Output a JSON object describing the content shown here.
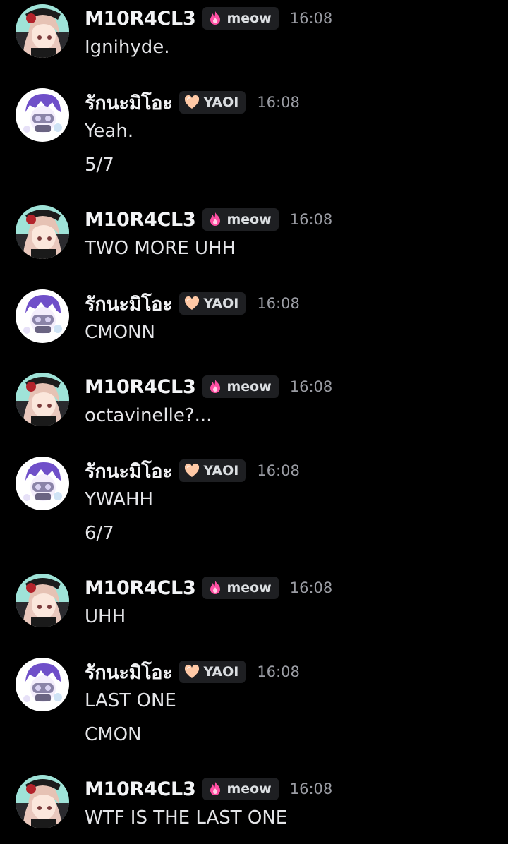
{
  "users": {
    "miracle": {
      "name": "M10R4CL3",
      "tag": "meow",
      "tag_icon": "pink-flame-icon",
      "tag_icon_color": "#ff4fa3"
    },
    "thai": {
      "name": "รักนะมิโอะ",
      "tag": "YAOI",
      "tag_icon": "peach-heart-icon",
      "tag_icon_color": "#ffc9a6"
    }
  },
  "messages": [
    {
      "user": "M10R4CL3",
      "tag": "meow",
      "time": "16:08",
      "lines": [
        "Ignihyde."
      ]
    },
    {
      "user": "รักนะมิโอะ",
      "tag": "YAOI",
      "time": "16:08",
      "lines": [
        "Yeah.",
        "5/7"
      ]
    },
    {
      "user": "M10R4CL3",
      "tag": "meow",
      "time": "16:08",
      "lines": [
        "TWO MORE UHH"
      ]
    },
    {
      "user": "รักนะมิโอะ",
      "tag": "YAOI",
      "time": "16:08",
      "lines": [
        "CMONN"
      ]
    },
    {
      "user": "M10R4CL3",
      "tag": "meow",
      "time": "16:08",
      "lines": [
        "octavinelle?..."
      ]
    },
    {
      "user": "รักนะมิโอะ",
      "tag": "YAOI",
      "time": "16:08",
      "lines": [
        "YWAHH",
        "6/7"
      ]
    },
    {
      "user": "M10R4CL3",
      "tag": "meow",
      "time": "16:08",
      "lines": [
        "UHH"
      ]
    },
    {
      "user": "รักนะมิโอะ",
      "tag": "YAOI",
      "time": "16:08",
      "lines": [
        "LAST ONE",
        "CMON"
      ]
    },
    {
      "user": "M10R4CL3",
      "tag": "meow",
      "time": "16:08",
      "lines": [
        "WTF IS THE LAST ONE"
      ]
    }
  ],
  "colors": {
    "background": "#000000",
    "username": "#f2f3f5",
    "timestamp": "#9a9ca3",
    "message_text": "#e4e5e8",
    "tag_background": "#1e1f22"
  }
}
